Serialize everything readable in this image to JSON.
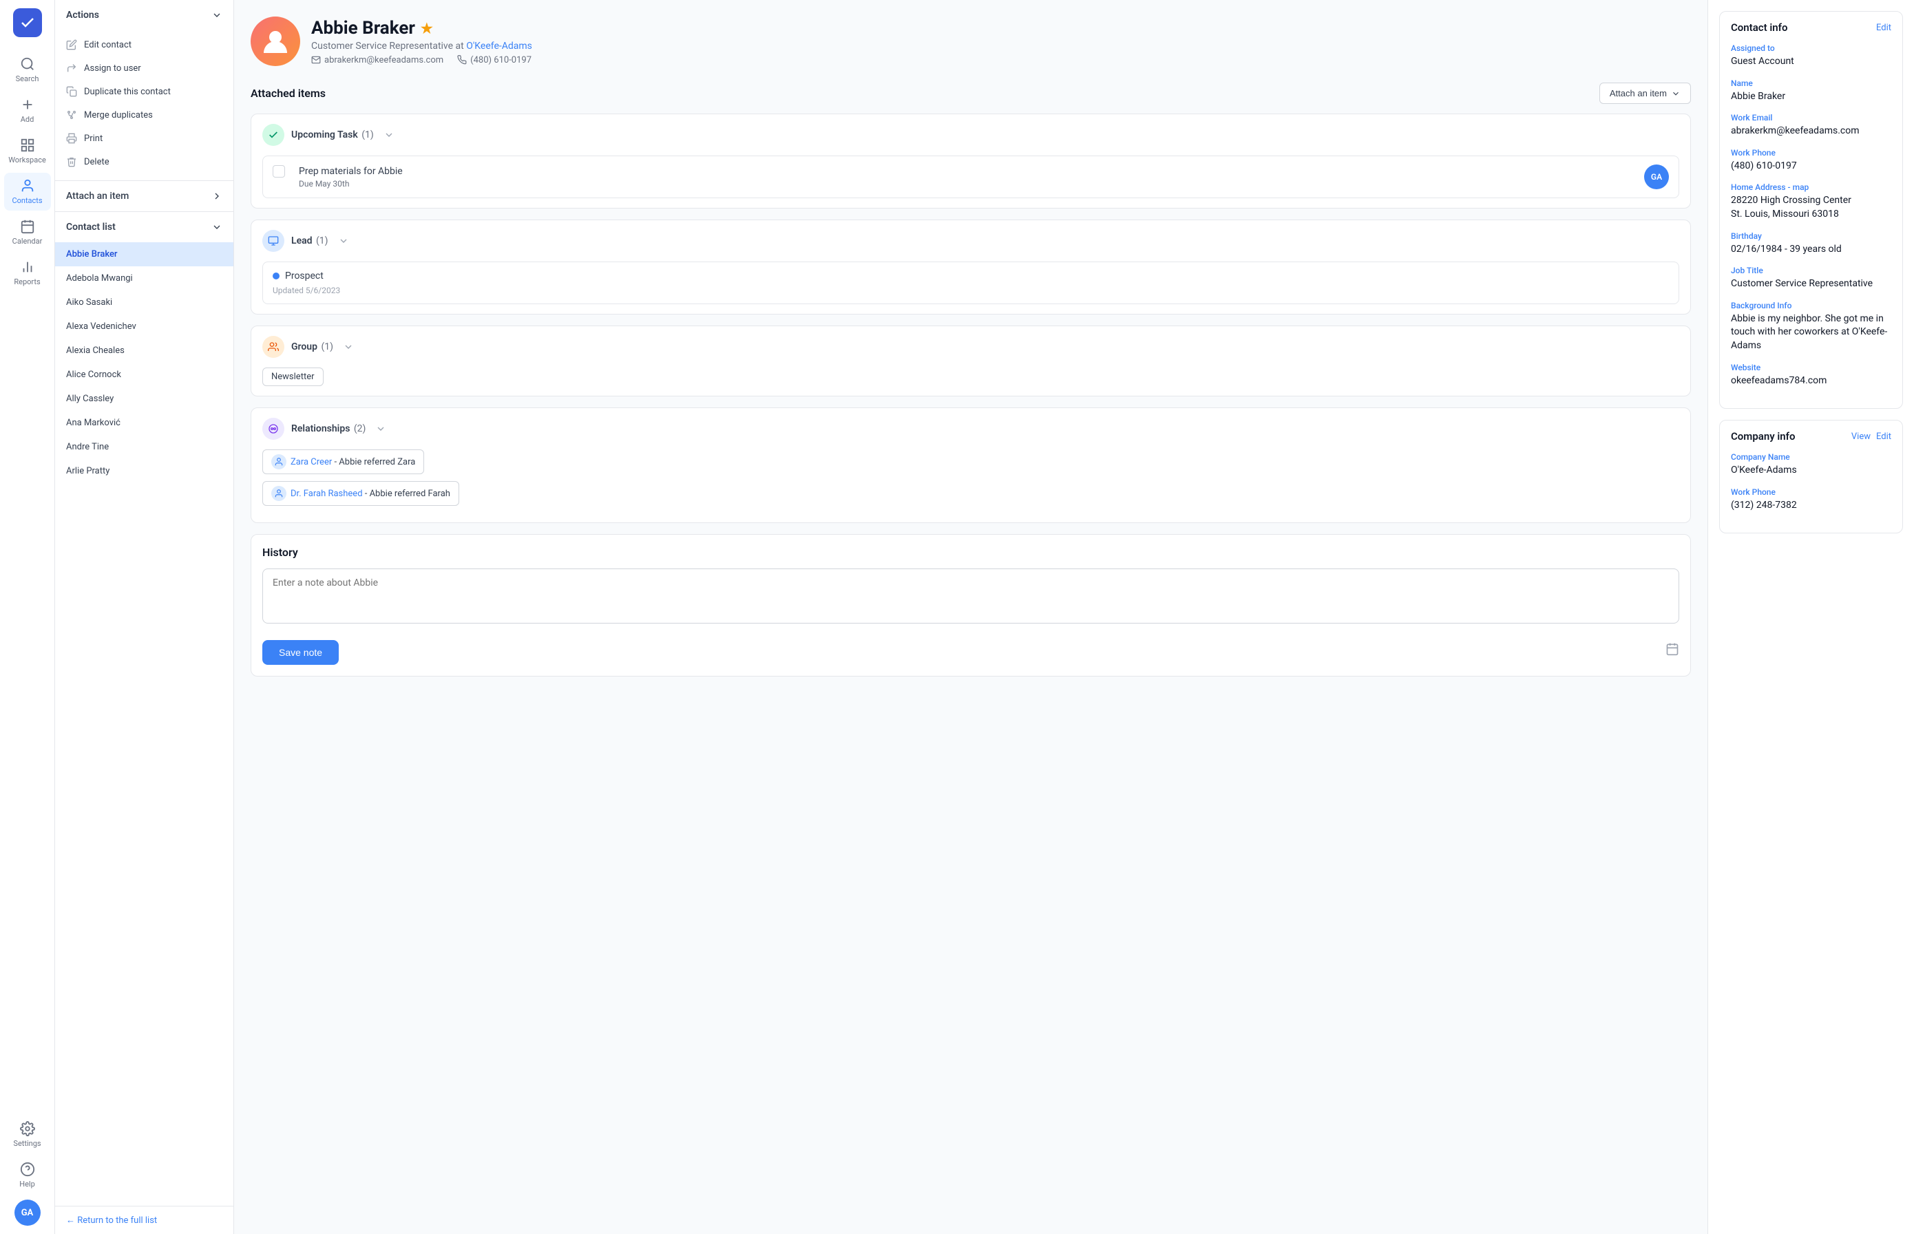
{
  "nav": {
    "logo_initials": "✓",
    "items": [
      {
        "id": "search",
        "label": "Search",
        "icon": "search"
      },
      {
        "id": "add",
        "label": "Add",
        "icon": "plus"
      },
      {
        "id": "workspace",
        "label": "Workspace",
        "icon": "grid"
      },
      {
        "id": "contacts",
        "label": "Contacts",
        "icon": "person",
        "active": true
      },
      {
        "id": "calendar",
        "label": "Calendar",
        "icon": "calendar"
      },
      {
        "id": "reports",
        "label": "Reports",
        "icon": "bar-chart"
      },
      {
        "id": "settings",
        "label": "Settings",
        "icon": "gear"
      },
      {
        "id": "help",
        "label": "Help",
        "icon": "question"
      }
    ],
    "user_initials": "GA"
  },
  "sidebar": {
    "actions_label": "Actions",
    "actions": [
      {
        "id": "edit",
        "label": "Edit contact",
        "icon": "pencil"
      },
      {
        "id": "assign",
        "label": "Assign to user",
        "icon": "share"
      },
      {
        "id": "duplicate",
        "label": "Duplicate this contact",
        "icon": "copy"
      },
      {
        "id": "merge",
        "label": "Merge duplicates",
        "icon": "merge"
      },
      {
        "id": "print",
        "label": "Print",
        "icon": "printer"
      },
      {
        "id": "delete",
        "label": "Delete",
        "icon": "trash"
      }
    ],
    "attach_item_label": "Attach an item",
    "contact_list_label": "Contact list",
    "contacts": [
      {
        "id": "abbie",
        "name": "Abbie Braker",
        "active": true
      },
      {
        "id": "adebola",
        "name": "Adebola Mwangi"
      },
      {
        "id": "aiko",
        "name": "Aiko Sasaki"
      },
      {
        "id": "alexa",
        "name": "Alexa Vedenichev"
      },
      {
        "id": "alexia",
        "name": "Alexia Cheales"
      },
      {
        "id": "alice",
        "name": "Alice Cornock"
      },
      {
        "id": "ally",
        "name": "Ally Cassley"
      },
      {
        "id": "ana",
        "name": "Ana Marković"
      },
      {
        "id": "andre",
        "name": "Andre Tine"
      },
      {
        "id": "arlie",
        "name": "Arlie Pratty"
      }
    ],
    "return_link": "← Return to the full list"
  },
  "profile": {
    "name": "Abbie Braker",
    "role": "Customer Service Representative at",
    "company_link": "O'Keefe-Adams",
    "email": "abrakerkm@keefeadams.com",
    "phone": "(480) 610-0197"
  },
  "attached_items": {
    "section_title": "Attached items",
    "attach_btn_label": "Attach an item",
    "sections": [
      {
        "id": "task",
        "icon_type": "green",
        "title": "Upcoming Task",
        "count": "(1)",
        "items": [
          {
            "type": "task",
            "text": "Prep materials for Abbie",
            "due": "Due May 30th",
            "avatar": "GA"
          }
        ]
      },
      {
        "id": "lead",
        "icon_type": "blue",
        "title": "Lead",
        "count": "(1)",
        "items": [
          {
            "type": "lead",
            "status": "Prospect",
            "updated": "Updated 5/6/2023"
          }
        ]
      },
      {
        "id": "group",
        "icon_type": "orange",
        "title": "Group",
        "count": "(1)",
        "items": [
          {
            "type": "group",
            "name": "Newsletter"
          }
        ]
      },
      {
        "id": "relationships",
        "icon_type": "purple",
        "title": "Relationships",
        "count": "(2)",
        "items": [
          {
            "type": "relationship",
            "name": "Zara Creer",
            "description": "Abbie referred Zara"
          },
          {
            "type": "relationship",
            "name": "Dr. Farah Rasheed",
            "description": "Abbie referred Farah"
          }
        ]
      }
    ]
  },
  "history": {
    "title": "History",
    "placeholder": "Enter a note about Abbie",
    "save_btn": "Save note"
  },
  "contact_info": {
    "title": "Contact info",
    "edit_label": "Edit",
    "fields": [
      {
        "label": "Assigned to",
        "value": "Guest Account"
      },
      {
        "label": "Name",
        "value": "Abbie Braker"
      },
      {
        "label": "Work Email",
        "value": "abrakerkm@keefeadams.com"
      },
      {
        "label": "Work Phone",
        "value": "(480) 610-0197"
      },
      {
        "label": "Home Address",
        "value": "28220 High Crossing Center\nSt. Louis, Missouri 63018",
        "has_map": true
      },
      {
        "label": "Birthday",
        "value": "02/16/1984 - 39 years old"
      },
      {
        "label": "Job Title",
        "value": "Customer Service Representative"
      },
      {
        "label": "Background Info",
        "value": "Abbie is my neighbor. She got me in touch with her coworkers at O'Keefe-Adams"
      },
      {
        "label": "Website",
        "value": "okeefeadams784.com"
      }
    ]
  },
  "company_info": {
    "title": "Company info",
    "view_label": "View",
    "edit_label": "Edit",
    "fields": [
      {
        "label": "Company Name",
        "value": "O'Keefe-Adams"
      },
      {
        "label": "Work Phone",
        "value": "(312) 248-7382"
      }
    ]
  }
}
